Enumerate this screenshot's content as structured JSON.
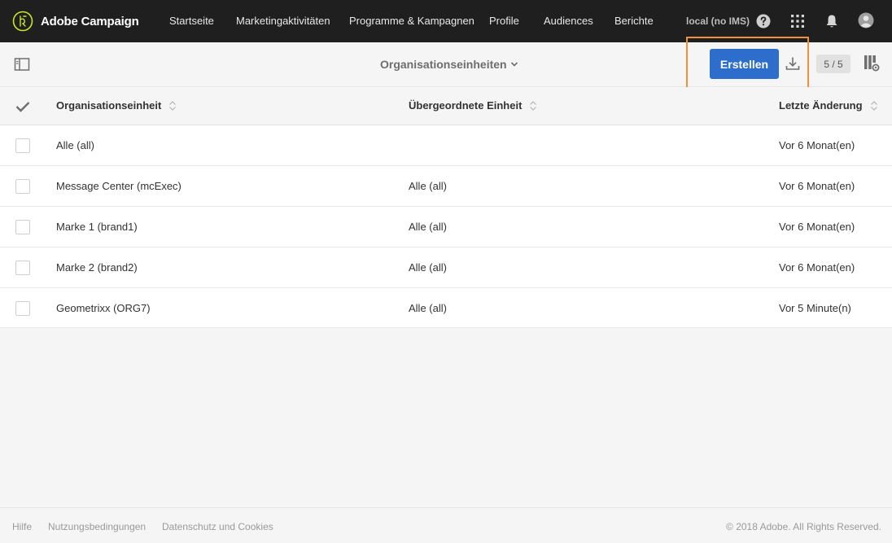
{
  "app": {
    "name": "Adobe Campaign",
    "nav": [
      "Startseite",
      "Marketingaktivitäten",
      "Programme & Kampagnen",
      "Profile",
      "Audiences",
      "Berichte"
    ],
    "environment": "local (no IMS)",
    "icons": [
      "help-icon",
      "apps-grid-icon",
      "notifications-bell-icon",
      "user-avatar-icon"
    ]
  },
  "toolbar": {
    "view_title": "Organisationseinheiten",
    "create_label": "Erstellen",
    "count": "5 / 5"
  },
  "table": {
    "columns": [
      "Organisationseinheit",
      "Übergeordnete Einheit",
      "Letzte Änderung"
    ],
    "rows": [
      {
        "unit": "Alle (all)",
        "parent": "",
        "modified": "Vor 6 Monat(en)"
      },
      {
        "unit": "Message Center (mcExec)",
        "parent": "Alle (all)",
        "modified": "Vor 6 Monat(en)"
      },
      {
        "unit": "Marke 1 (brand1)",
        "parent": "Alle (all)",
        "modified": "Vor 6 Monat(en)"
      },
      {
        "unit": "Marke 2 (brand2)",
        "parent": "Alle (all)",
        "modified": "Vor 6 Monat(en)"
      },
      {
        "unit": "Geometrixx (ORG7)",
        "parent": "Alle (all)",
        "modified": "Vor 5 Minute(n)"
      }
    ]
  },
  "footer": {
    "links": [
      "Hilfe",
      "Nutzungsbedingungen",
      "Datenschutz und Cookies"
    ],
    "copyright": "© 2018 Adobe. All Rights Reserved."
  },
  "colors": {
    "nav_background": "#1f1f1f",
    "primary_button": "#2d6dcc",
    "highlight": "#f0913a",
    "logo_accent": "#c8e62b"
  }
}
